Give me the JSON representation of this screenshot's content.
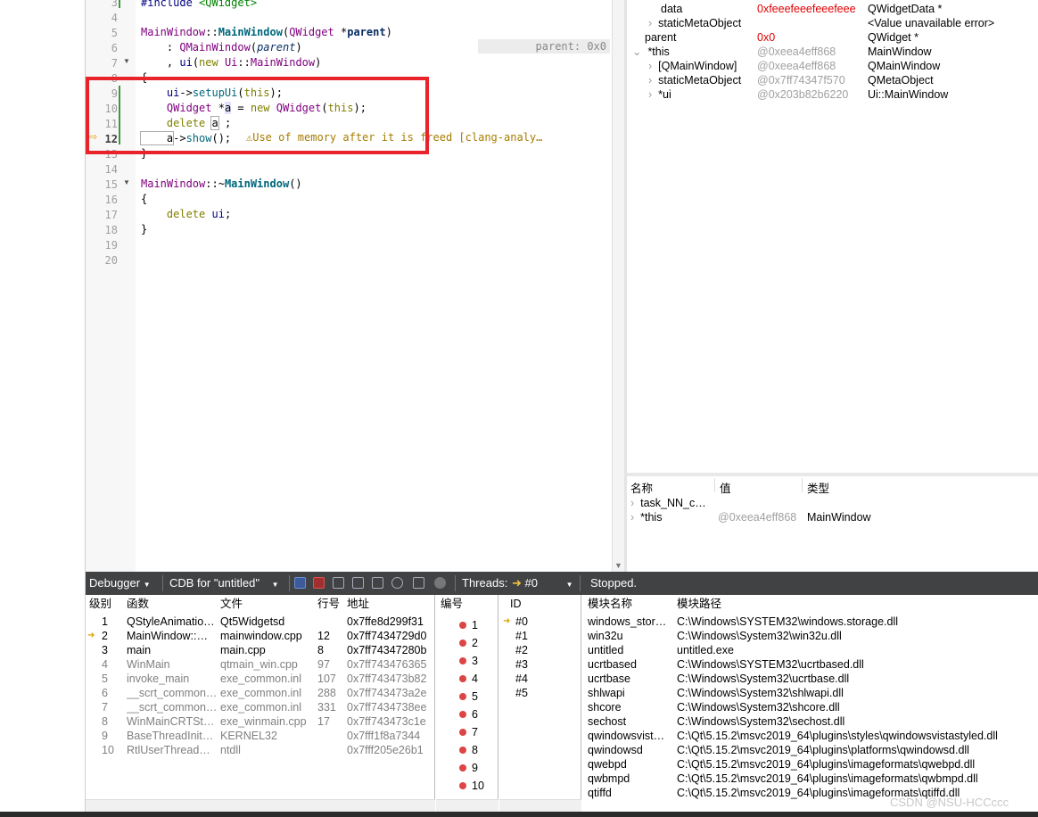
{
  "editor": {
    "line_numbers": [
      "3",
      "4",
      "5",
      "6",
      "7",
      "8",
      "9",
      "10",
      "11",
      "12",
      "13",
      "14",
      "15",
      "16",
      "17",
      "18",
      "19",
      "20"
    ],
    "current_line": "12",
    "code": {
      "l3_include": "#include",
      "l3_header": "<QWidget>",
      "l5_class": "MainWindow",
      "l5_sep": "::",
      "l5_ctor": "MainWindow",
      "l5_open": "(",
      "l5_type": "QWidget",
      "l5_star": " *",
      "l5_param": "parent",
      "l5_close": ")",
      "l6_prefix": "    : ",
      "l6_base": "QMainWindow",
      "l6_open": "(",
      "l6_arg": "parent",
      "l6_close": ")",
      "l7_prefix": "    , ",
      "l7_ui": "ui",
      "l7_open": "(",
      "l7_new": "new",
      "l7_ns": " Ui",
      "l7_sep": "::",
      "l7_cls": "MainWindow",
      "l7_close": ")",
      "l8": "{",
      "l9_ui": "    ui",
      "l9_arrow": "->",
      "l9_fn": "setupUi",
      "l9_open": "(",
      "l9_this": "this",
      "l9_close": ");",
      "l10_type": "    QWidget",
      "l10_star": " *",
      "l10_var": "a",
      "l10_eq": " = ",
      "l10_new": "new",
      "l10_cls": " QWidget",
      "l10_open": "(",
      "l10_this": "this",
      "l10_close": ");",
      "l11_del": "    delete",
      "l11_sp": " ",
      "l11_var": "a",
      "l11_end": " ;",
      "l12_var": "    a",
      "l12_arrow": "->",
      "l12_fn": "show",
      "l12_end": "();",
      "l13": "}",
      "l15_class": "MainWindow",
      "l15_sep": "::~",
      "l15_dtor": "MainWindow",
      "l15_paren": "()",
      "l16": "{",
      "l17_del": "    delete",
      "l17_ui": " ui",
      "l17_end": ";",
      "l18": "}"
    },
    "parent_annotation": "parent: 0x0",
    "warning_icon": "warning-triangle-icon",
    "warning_text": "Use of memory after it is freed [clang-analy…"
  },
  "locals": {
    "rows": [
      {
        "name": "data",
        "value": "0xfeeefeeefeeefeee",
        "type": "QWidgetData *"
      },
      {
        "name": "staticMetaObject",
        "value": "",
        "type": "<Value unavailable error>"
      },
      {
        "name": "parent",
        "value": "0x0",
        "type": "QWidget *"
      },
      {
        "name": "*this",
        "value": "@0xeea4eff868",
        "type": "MainWindow"
      },
      {
        "name": "[QMainWindow]",
        "value": "@0xeea4eff868",
        "type": "QMainWindow"
      },
      {
        "name": "staticMetaObject",
        "value": "@0x7ff74347f570",
        "type": "QMetaObject"
      },
      {
        "name": "*ui",
        "value": "@0x203b82b6220",
        "type": "Ui::MainWindow"
      }
    ]
  },
  "watch": {
    "headers": {
      "name": "名称",
      "value": "值",
      "type": "类型"
    },
    "rows": [
      {
        "name": "task_NN_c…",
        "value": "",
        "type": ""
      },
      {
        "name": "*this",
        "value": "@0xeea4eff868",
        "type": "MainWindow"
      }
    ]
  },
  "toolbar": {
    "debugger_label": "Debugger",
    "engine_label": "CDB for \"untitled\"",
    "threads_label": "Threads:",
    "thread_value": "#0",
    "status": "Stopped."
  },
  "stack": {
    "headers": {
      "level": "级别",
      "function": "函数",
      "file": "文件",
      "line": "行号",
      "address": "地址"
    },
    "current_level": "2",
    "rows": [
      {
        "level": "1",
        "function": "QStyleAnimatio…",
        "file": "Qt5Widgetsd",
        "line": "",
        "address": "0x7ffe8d299f31"
      },
      {
        "level": "2",
        "function": "MainWindow::…",
        "file": "mainwindow.cpp",
        "line": "12",
        "address": "0x7ff7434729d0"
      },
      {
        "level": "3",
        "function": "main",
        "file": "main.cpp",
        "line": "8",
        "address": "0x7ff74347280b"
      },
      {
        "level": "4",
        "function": "WinMain",
        "file": "qtmain_win.cpp",
        "line": "97",
        "address": "0x7ff743476365"
      },
      {
        "level": "5",
        "function": "invoke_main",
        "file": "exe_common.inl",
        "line": "107",
        "address": "0x7ff743473b82"
      },
      {
        "level": "6",
        "function": "__scrt_common…",
        "file": "exe_common.inl",
        "line": "288",
        "address": "0x7ff743473a2e"
      },
      {
        "level": "7",
        "function": "__scrt_common…",
        "file": "exe_common.inl",
        "line": "331",
        "address": "0x7ff7434738ee"
      },
      {
        "level": "8",
        "function": "WinMainCRTSt…",
        "file": "exe_winmain.cpp",
        "line": "17",
        "address": "0x7ff743473c1e"
      },
      {
        "level": "9",
        "function": "BaseThreadInit…",
        "file": "KERNEL32",
        "line": "",
        "address": "0x7fff1f8a7344"
      },
      {
        "level": "10",
        "function": "RtlUserThread…",
        "file": "ntdll",
        "line": "",
        "address": "0x7fff205e26b1"
      }
    ]
  },
  "breakpoints": {
    "header": "编号",
    "items": [
      "1",
      "2",
      "3",
      "4",
      "5",
      "6",
      "7",
      "8",
      "9",
      "10"
    ]
  },
  "threads": {
    "header": "ID",
    "items": [
      "#0",
      "#1",
      "#2",
      "#3",
      "#4",
      "#5"
    ]
  },
  "modules": {
    "headers": {
      "name": "模块名称",
      "path": "模块路径"
    },
    "rows": [
      {
        "name": "windows_stor…",
        "path": "C:\\Windows\\SYSTEM32\\windows.storage.dll"
      },
      {
        "name": "win32u",
        "path": "C:\\Windows\\System32\\win32u.dll"
      },
      {
        "name": "untitled",
        "path": "untitled.exe"
      },
      {
        "name": "ucrtbased",
        "path": "C:\\Windows\\SYSTEM32\\ucrtbased.dll"
      },
      {
        "name": "ucrtbase",
        "path": "C:\\Windows\\System32\\ucrtbase.dll"
      },
      {
        "name": "shlwapi",
        "path": "C:\\Windows\\System32\\shlwapi.dll"
      },
      {
        "name": "shcore",
        "path": "C:\\Windows\\System32\\shcore.dll"
      },
      {
        "name": "sechost",
        "path": "C:\\Windows\\System32\\sechost.dll"
      },
      {
        "name": "qwindowsvist…",
        "path": "C:\\Qt\\5.15.2\\msvc2019_64\\plugins\\styles\\qwindowsvistastyled.dll"
      },
      {
        "name": "qwindowsd",
        "path": "C:\\Qt\\5.15.2\\msvc2019_64\\plugins\\platforms\\qwindowsd.dll"
      },
      {
        "name": "qwebpd",
        "path": "C:\\Qt\\5.15.2\\msvc2019_64\\plugins\\imageformats\\qwebpd.dll"
      },
      {
        "name": "qwbmpd",
        "path": "C:\\Qt\\5.15.2\\msvc2019_64\\plugins\\imageformats\\qwbmpd.dll"
      },
      {
        "name": "qtiffd",
        "path": "C:\\Qt\\5.15.2\\msvc2019_64\\plugins\\imageformats\\qtiffd.dll"
      }
    ]
  },
  "watermark": "CSDN @NSU-HCCccc",
  "colors": {
    "highlight_box": "#e8242a",
    "toolbar_bg": "#404244",
    "warning": "#f0b400"
  }
}
